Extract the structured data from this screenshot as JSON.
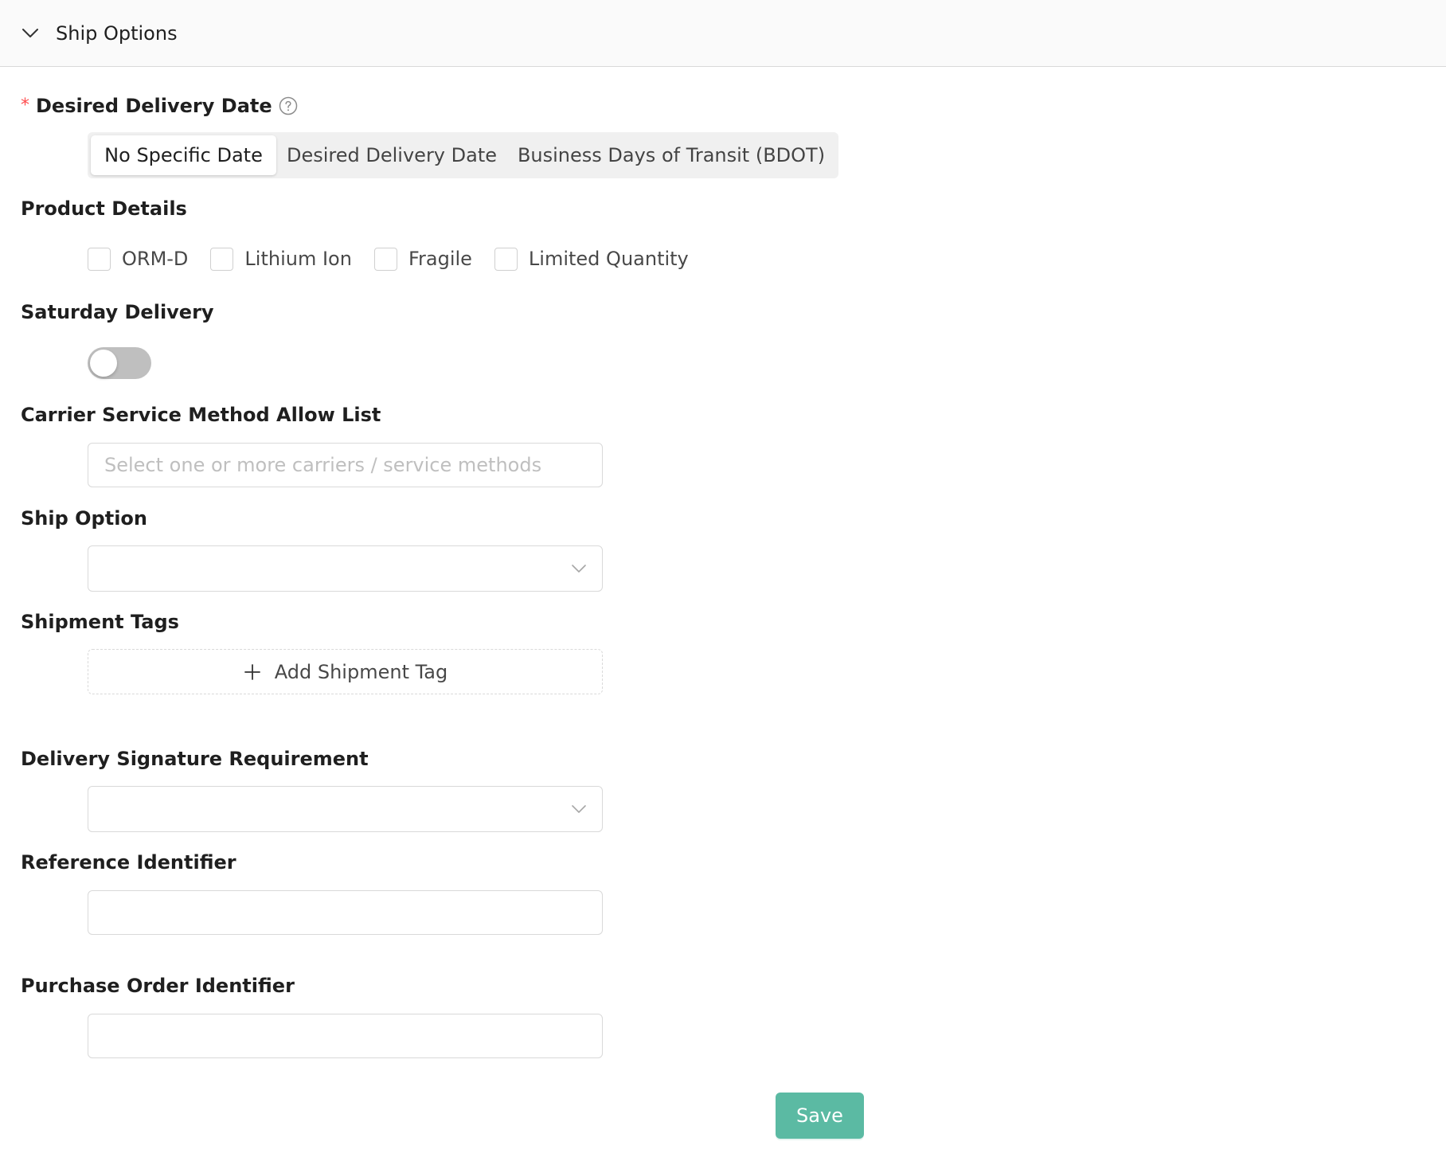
{
  "panel": {
    "title": "Ship Options"
  },
  "desired_delivery_date": {
    "label": "Desired Delivery Date",
    "required_mark": "*",
    "options": [
      {
        "label": "No Specific Date",
        "selected": true
      },
      {
        "label": "Desired Delivery Date",
        "selected": false
      },
      {
        "label": "Business Days of Transit (BDOT)",
        "selected": false
      }
    ]
  },
  "product_details": {
    "label": "Product Details",
    "options": [
      {
        "label": "ORM-D",
        "checked": false
      },
      {
        "label": "Lithium Ion",
        "checked": false
      },
      {
        "label": "Fragile",
        "checked": false
      },
      {
        "label": "Limited Quantity",
        "checked": false
      }
    ]
  },
  "saturday_delivery": {
    "label": "Saturday Delivery",
    "enabled": false
  },
  "carrier_allow_list": {
    "label": "Carrier Service Method Allow List",
    "placeholder": "Select one or more carriers / service methods",
    "value": ""
  },
  "ship_option": {
    "label": "Ship Option",
    "value": ""
  },
  "shipment_tags": {
    "label": "Shipment Tags",
    "add_label": "Add Shipment Tag"
  },
  "delivery_signature": {
    "label": "Delivery Signature Requirement",
    "value": ""
  },
  "reference_identifier": {
    "label": "Reference Identifier",
    "value": ""
  },
  "purchase_order_identifier": {
    "label": "Purchase Order Identifier",
    "value": ""
  },
  "actions": {
    "save_label": "Save"
  },
  "colors": {
    "primary": "#5bbaa3",
    "required": "#ff4d4f",
    "border": "#d9d9d9",
    "switch_off": "#bfbfbf"
  },
  "icons": {
    "collapse": "chevron-down-icon",
    "help": "question-circle-icon",
    "select_arrow": "chevron-down-icon",
    "add": "plus-icon"
  }
}
